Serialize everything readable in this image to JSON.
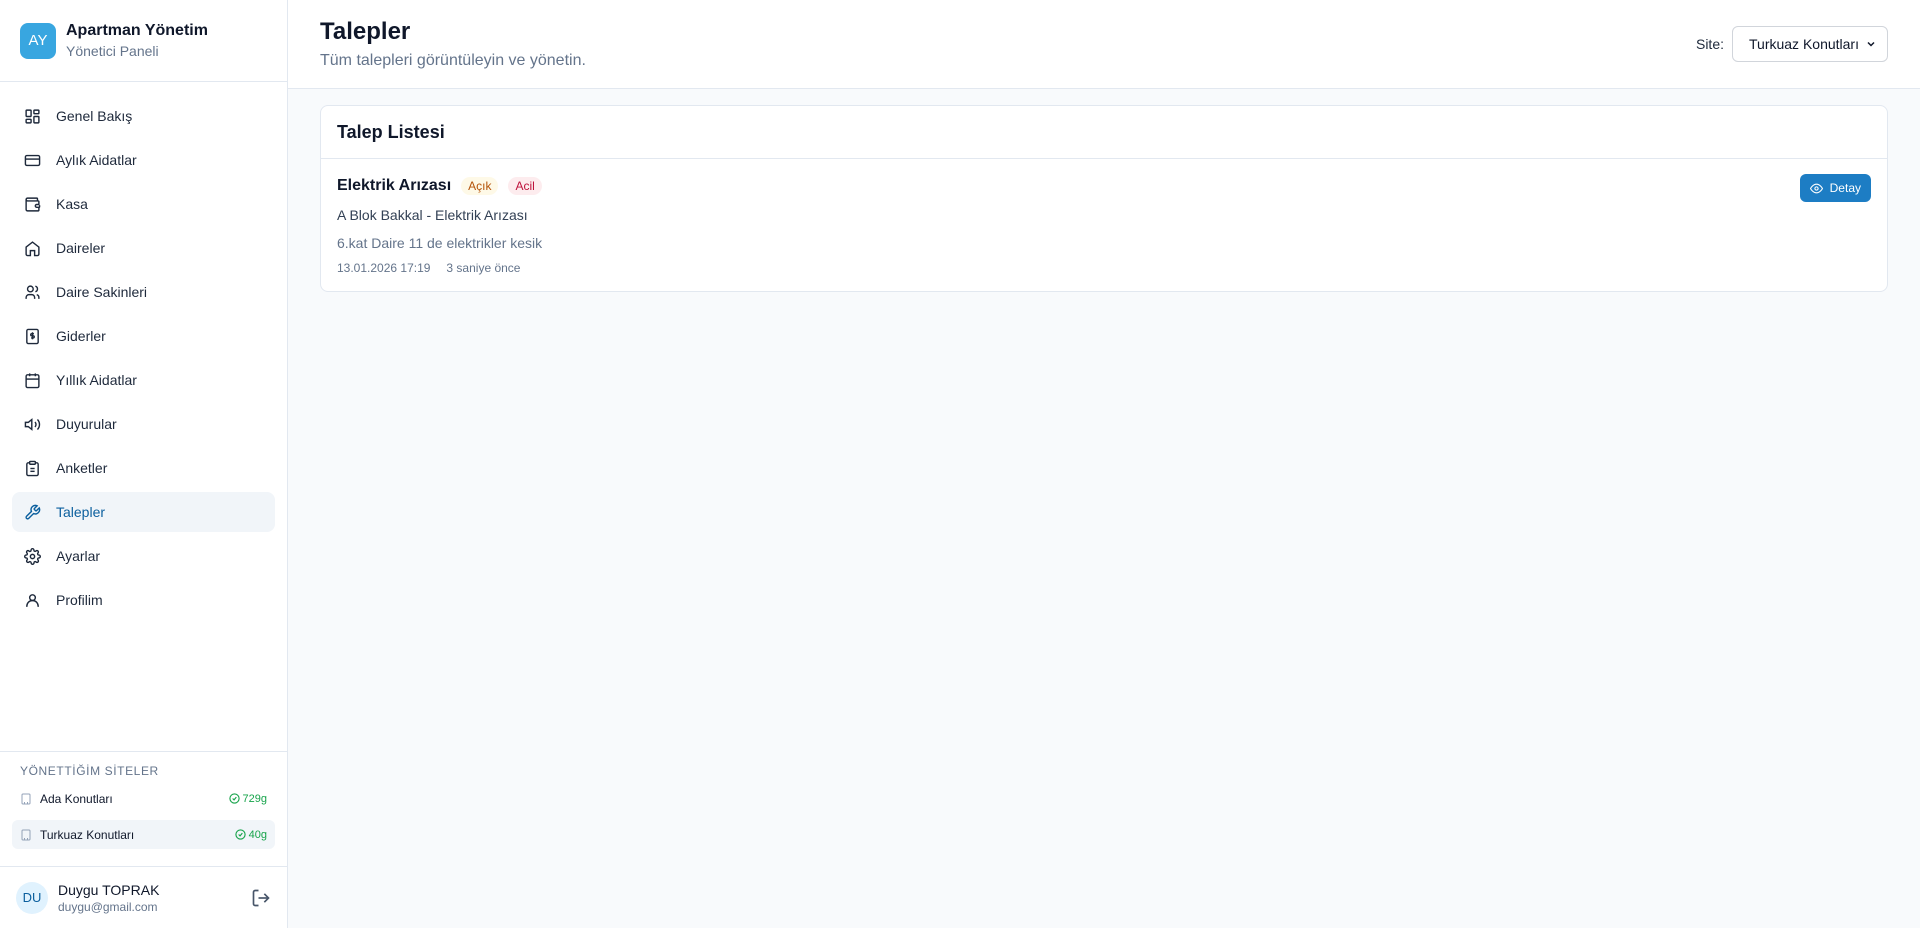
{
  "brand": {
    "initials": "AY",
    "title": "Apartman Yönetim",
    "subtitle": "Yönetici Paneli"
  },
  "nav": [
    {
      "label": "Genel Bakış",
      "icon": "grid-icon"
    },
    {
      "label": "Aylık Aidatlar",
      "icon": "credit-card-icon"
    },
    {
      "label": "Kasa",
      "icon": "wallet-icon"
    },
    {
      "label": "Daireler",
      "icon": "home-icon"
    },
    {
      "label": "Daire Sakinleri",
      "icon": "users-icon"
    },
    {
      "label": "Giderler",
      "icon": "receipt-icon"
    },
    {
      "label": "Yıllık Aidatlar",
      "icon": "calendar-icon"
    },
    {
      "label": "Duyurular",
      "icon": "megaphone-icon"
    },
    {
      "label": "Anketler",
      "icon": "clipboard-icon"
    },
    {
      "label": "Talepler",
      "icon": "wrench-icon",
      "active": true
    },
    {
      "label": "Ayarlar",
      "icon": "gear-icon"
    },
    {
      "label": "Profilim",
      "icon": "user-icon"
    }
  ],
  "sites": {
    "title": "YÖNETTİĞİM SİTELER",
    "items": [
      {
        "name": "Ada Konutları",
        "days": "729g"
      },
      {
        "name": "Turkuaz Konutları",
        "days": "40g",
        "active": true
      }
    ]
  },
  "user": {
    "initials": "DU",
    "name": "Duygu TOPRAK",
    "email": "duygu@gmail.com"
  },
  "header": {
    "title": "Talepler",
    "subtitle": "Tüm talepleri görüntüleyin ve yönetin.",
    "site_label": "Site:",
    "site_selected": "Turkuaz Konutları"
  },
  "list": {
    "title": "Talep Listesi",
    "tickets": [
      {
        "title": "Elektrik Arızası",
        "status": "Açık",
        "priority": "Acil",
        "subject": "A Blok Bakkal - Elektrik Arızası",
        "description": "6.kat Daire 11 de elektrikler kesik",
        "date": "13.01.2026 17:19",
        "relative": "3 saniye önce",
        "button": "Detay"
      }
    ]
  },
  "colors": {
    "accent": "#1d7dc4",
    "brand": "#38a6e0",
    "success": "#16a34a"
  }
}
